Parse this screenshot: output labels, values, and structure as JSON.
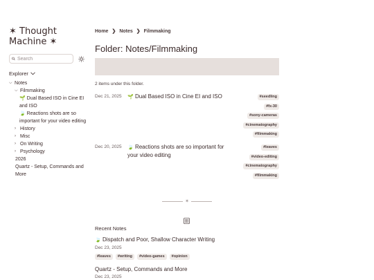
{
  "site": {
    "title": "✶ Thought Machine ✶"
  },
  "search": {
    "placeholder": "Search"
  },
  "explorer": {
    "label": "Explorer",
    "tree": {
      "notes": "Notes",
      "filmmaking": "Filmmaking",
      "film_item_1_emoji": "🌱",
      "film_item_1": "Dual Based ISO in Cine EI and ISO",
      "film_item_2_emoji": "🍃",
      "film_item_2": "Reactions shots are so important for your video editing",
      "history": "History",
      "misc": "Misc",
      "on_writing": "On Writing",
      "psychology": "Psychology",
      "year": "2026",
      "quartz": "Quartz - Setup, Commands and More"
    }
  },
  "breadcrumb": {
    "home": "Home",
    "notes": "Notes",
    "current": "Filmmaking",
    "separator": "❯"
  },
  "page": {
    "title": "Folder: Notes/Filmmaking",
    "count": "2 items under this folder."
  },
  "folder_items": [
    {
      "date": "Dec 21, 2025",
      "emoji": "🌱",
      "title": "Dual Based ISO in Cine EI and ISO",
      "tags": [
        "#seedling",
        "#fx-30",
        "#sony-cameras",
        "#cinematography",
        "#filmmaking"
      ]
    },
    {
      "date": "Dec 20, 2025",
      "emoji": "🍃",
      "title": "Reactions shots are so important for your video editing",
      "tags": [
        "#leaves",
        "#video-editing",
        "#cinematography",
        "#filmmaking"
      ]
    }
  ],
  "divider": {
    "glyph": "✶"
  },
  "recent": {
    "header": "Recent Notes",
    "items": [
      {
        "emoji": "🍃",
        "title": "Dispatch and Poor, Shallow Character Writing",
        "date": "Dec 23, 2025",
        "tags": [
          "#leaves",
          "#writing",
          "#video-games",
          "#opinion"
        ]
      },
      {
        "title": "Quartz - Setup, Commands and More",
        "date": "Dec 23, 2025"
      }
    ]
  }
}
